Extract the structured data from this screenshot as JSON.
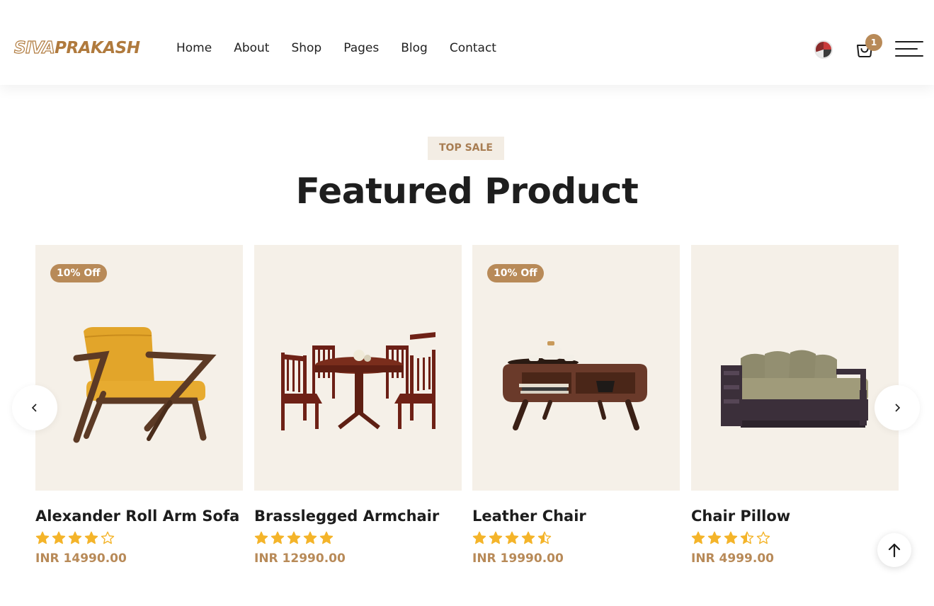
{
  "brand": {
    "logo_outline": "SIVA",
    "logo_solid": "PRAKASH"
  },
  "nav": {
    "items": [
      "Home",
      "About",
      "Shop",
      "Pages",
      "Blog",
      "Contact"
    ]
  },
  "header_actions": {
    "cart_count": "1"
  },
  "section": {
    "tag": "TOP SALE",
    "title": "Featured Product"
  },
  "products": [
    {
      "name": "Alexander Roll Arm Sofa",
      "price": "INR 14990.00",
      "badge": "10% Off",
      "rating": 4.0
    },
    {
      "name": "Brasslegged Armchair",
      "price": "INR 12990.00",
      "badge": "",
      "rating": 5.0
    },
    {
      "name": "Leather Chair",
      "price": "INR 19990.00",
      "badge": "10% Off",
      "rating": 4.5
    },
    {
      "name": "Chair Pillow",
      "price": "INR 4999.00",
      "badge": "",
      "rating": 3.5
    }
  ],
  "colors": {
    "accent": "#b88a58",
    "card_bg": "#f5f0e8",
    "star": "#f4b42a"
  }
}
